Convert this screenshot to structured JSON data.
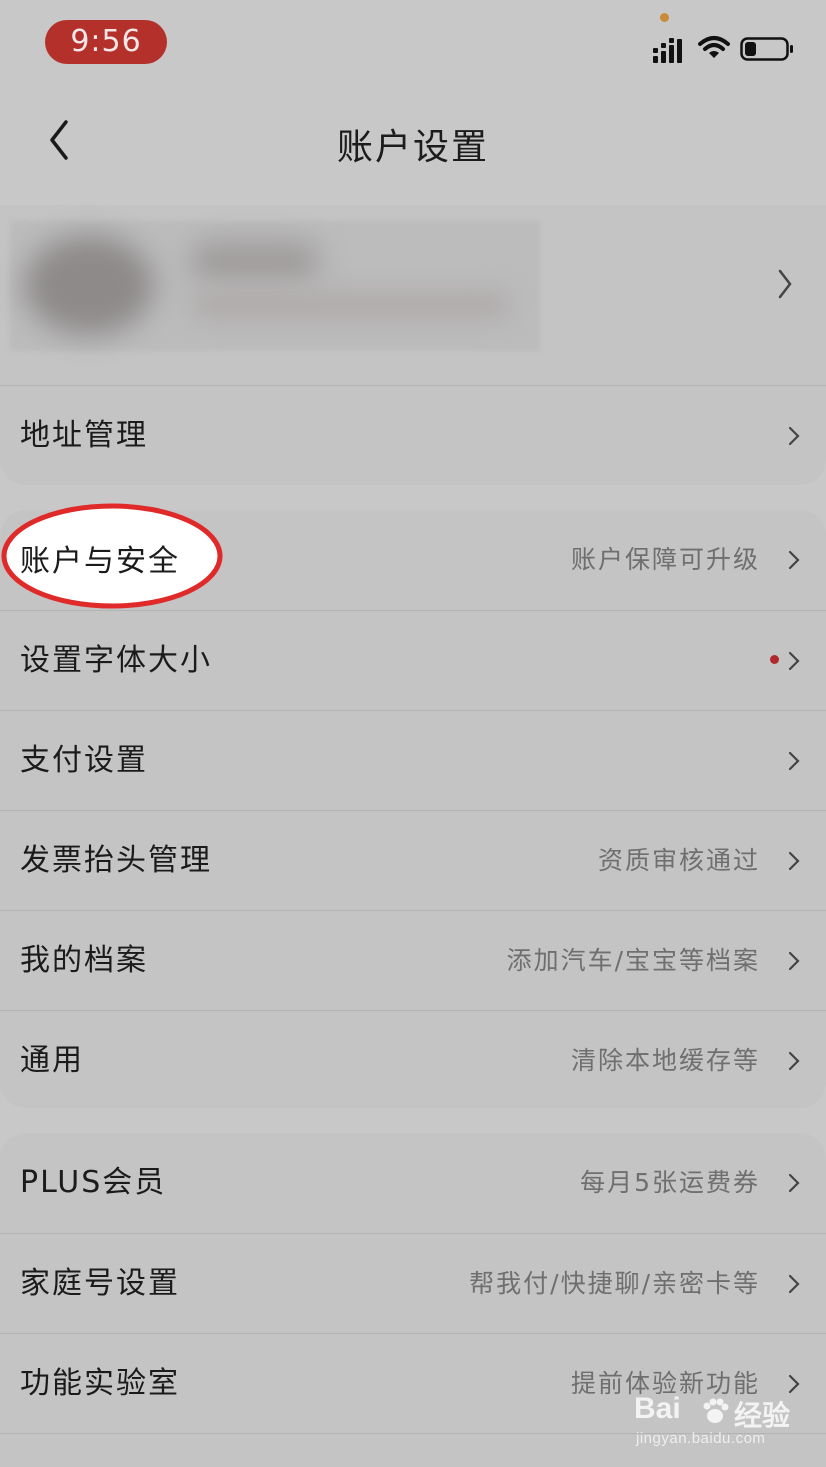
{
  "status_bar": {
    "time": "9:56",
    "icons": [
      "signal-icon",
      "wifi-icon",
      "battery-icon"
    ],
    "colors": {
      "time_pill": "#b3302b",
      "camera_indicator": "#c98a3a"
    }
  },
  "nav": {
    "title": "账户设置",
    "back_icon": "chevron-left-icon"
  },
  "profile": {
    "avatar": "avatar-blurred",
    "chevron_icon": "chevron-right-icon"
  },
  "section_top": {
    "items": [
      {
        "label": "地址管理",
        "value": ""
      }
    ]
  },
  "section_mid": {
    "items": [
      {
        "label": "账户与安全",
        "value": "账户保障可升级"
      },
      {
        "label": "设置字体大小",
        "value": ""
      },
      {
        "label": "支付设置",
        "value": ""
      },
      {
        "label": "发票抬头管理",
        "value": "资质审核通过"
      },
      {
        "label": "我的档案",
        "value": "添加汽车/宝宝等档案"
      },
      {
        "label": "通用",
        "value": "清除本地缓存等"
      }
    ]
  },
  "section_bot": {
    "items": [
      {
        "label": "PLUS会员",
        "value": "每月5张运费券"
      },
      {
        "label": "家庭号设置",
        "value": "帮我付/快捷聊/亲密卡等"
      },
      {
        "label": "功能实验室",
        "value": "提前体验新功能"
      }
    ]
  },
  "annotation": {
    "color": "#e02a2a"
  },
  "watermark": {
    "logo": "Bai",
    "brand": "经验",
    "url": "jingyan.baidu.com"
  }
}
